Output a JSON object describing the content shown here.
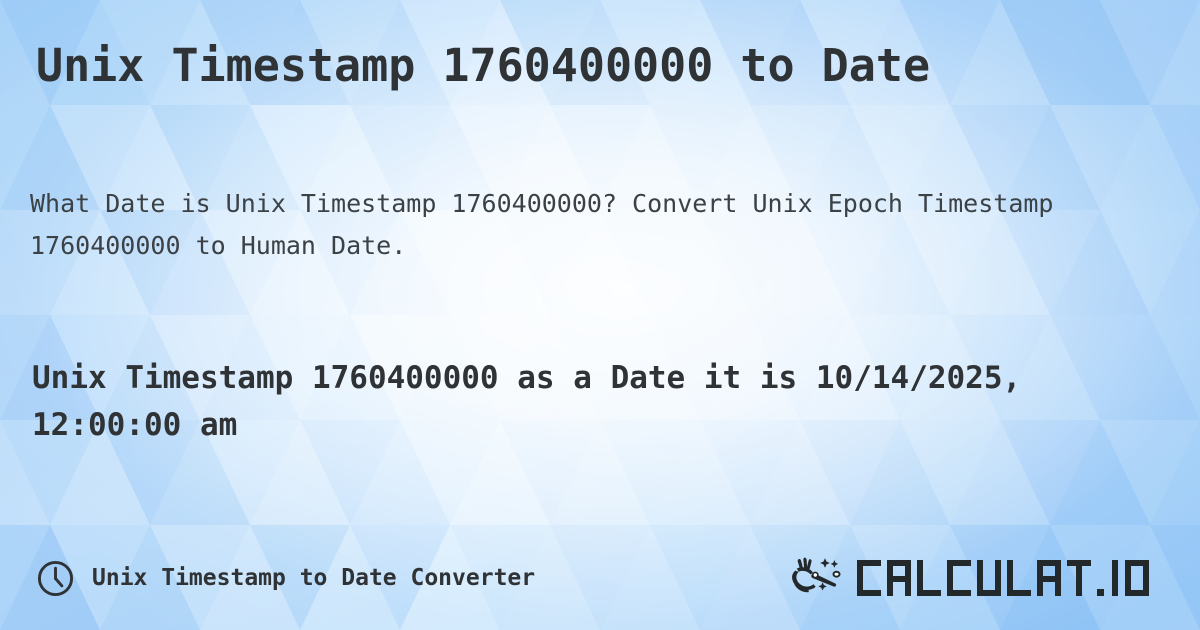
{
  "page": {
    "title": "Unix Timestamp 1760400000 to Date",
    "subtitle": "What Date is Unix Timestamp 1760400000? Convert Unix Epoch Timestamp 1760400000 to Human Date.",
    "result": "Unix Timestamp 1760400000 as a Date it is 10/14/2025, 12:00:00 am",
    "timestamp": "1760400000",
    "converted_date": "10/14/2025, 12:00:00 am"
  },
  "footer": {
    "icon": "clock-icon",
    "label": "Unix Timestamp to Date Converter"
  },
  "brand": {
    "icon": "magic-wand-hand-icon",
    "name": "CALCULAT.IO",
    "letters": [
      "C",
      "A",
      "L",
      "C",
      "U",
      "L",
      "A",
      "T",
      ".",
      "I",
      "O"
    ]
  },
  "colors": {
    "background_light": "#f4faff",
    "background_mid": "#bcdcfb",
    "background_deep": "#86bdf5",
    "text_primary": "#2f3336",
    "text_secondary": "#3b4145",
    "brand_dark": "#23282b"
  }
}
